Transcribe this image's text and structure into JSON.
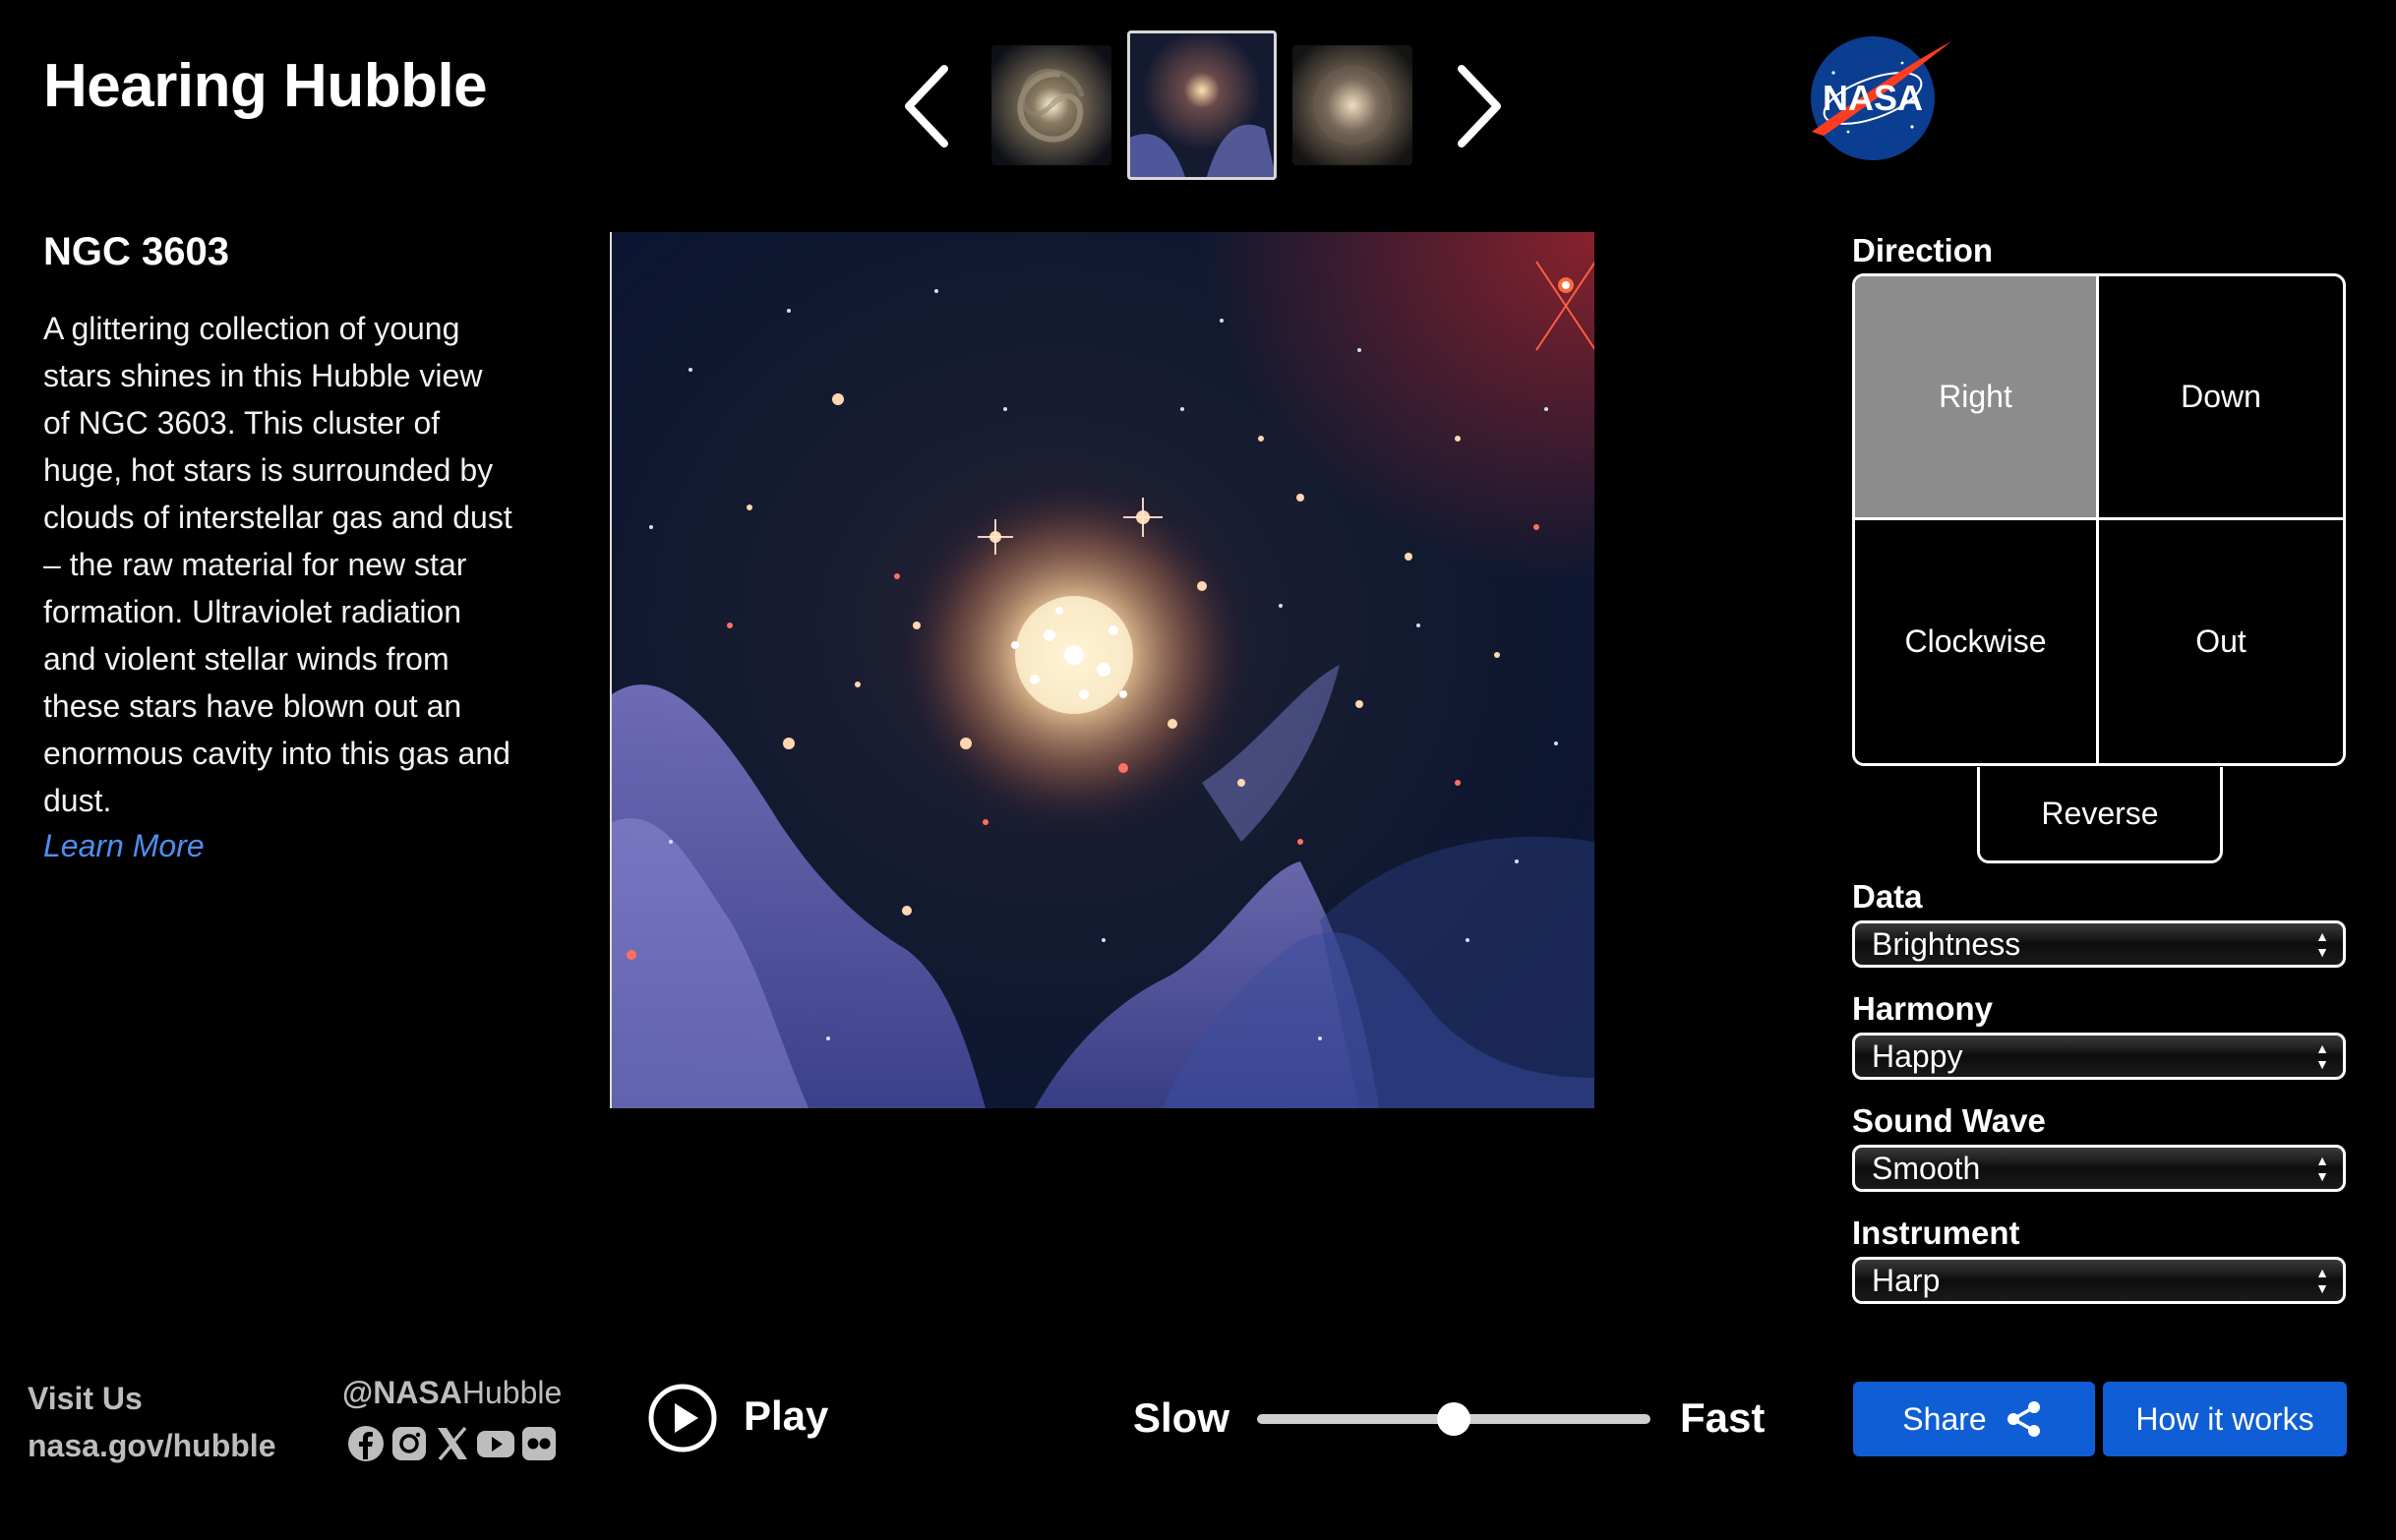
{
  "header": {
    "title": "Hearing Hubble"
  },
  "object": {
    "name": "NGC 3603",
    "description": "A glittering collection of young stars shines in this Hubble view of NGC 3603. This cluster of huge, hot stars is surrounded by clouds of interstellar gas and dust – the raw material for new star formation. Ultraviolet radiation and violent stellar winds from these stars have blown out an enormous cavity into this gas and dust.",
    "learn_more": "Learn More"
  },
  "controls": {
    "direction": {
      "label": "Direction",
      "options": [
        "Right",
        "Down",
        "Clockwise",
        "Out"
      ],
      "selected": "Right",
      "reverse_label": "Reverse"
    },
    "data": {
      "label": "Data",
      "value": "Brightness"
    },
    "harmony": {
      "label": "Harmony",
      "value": "Happy"
    },
    "sound_wave": {
      "label": "Sound Wave",
      "value": "Smooth"
    },
    "instrument": {
      "label": "Instrument",
      "value": "Harp"
    }
  },
  "footer": {
    "visit_label": "Visit Us",
    "visit_url": "nasa.gov/hubble",
    "handle_bold": "@NASA",
    "handle_rest": "Hubble",
    "social_icons": [
      "facebook-icon",
      "instagram-icon",
      "x-icon",
      "youtube-icon",
      "flickr-icon"
    ],
    "play_label": "Play",
    "speed_slow": "Slow",
    "speed_fast": "Fast",
    "speed_value": 0.5,
    "share_label": "Share",
    "how_label": "How it works"
  },
  "colors": {
    "accent_blue": "#0f5ed6",
    "link_blue": "#4f8df2",
    "selected_gray": "#8c8c8c"
  }
}
